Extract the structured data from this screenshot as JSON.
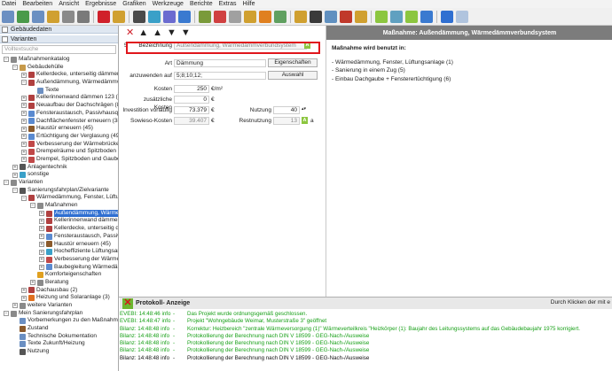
{
  "menu": [
    "Datei",
    "Bearbeiten",
    "Ansicht",
    "Ergebnisse",
    "Grafiken",
    "Werkzeuge",
    "Berichte",
    "Extras",
    "Hilfe"
  ],
  "panel": {
    "gebaeudedaten": "Gebäudedaten",
    "varianten": "Varianten",
    "search_placeholder": "Volltextsuche"
  },
  "tree": [
    {
      "label": "Maßnahmenkatalog",
      "indent": 0,
      "exp": "-",
      "icon": "#8a8a8a"
    },
    {
      "label": "Gebäudehülle",
      "indent": 1,
      "exp": "-",
      "icon": "#c79a4a"
    },
    {
      "label": "Kellerdecke, unterseitig dämmen (",
      "indent": 2,
      "exp": "+",
      "icon": "#b04040"
    },
    {
      "label": "Außendämmung, Wärmedämmverb",
      "indent": 2,
      "exp": "-",
      "icon": "#b04040"
    },
    {
      "label": "Texte",
      "indent": 3,
      "exp": "",
      "icon": "#6b8fc2"
    },
    {
      "label": "Kellerinnenwand dämmen 123 (7)",
      "indent": 2,
      "exp": "+",
      "icon": "#b04040"
    },
    {
      "label": "Neuaufbau der Dachschrägen (8)",
      "indent": 2,
      "exp": "+",
      "icon": "#b04040"
    },
    {
      "label": "Fensteraustausch, Passivhausqualitä",
      "indent": 2,
      "exp": "+",
      "icon": "#5a8ad0"
    },
    {
      "label": "Dachflächenfenster erneuern (38)",
      "indent": 2,
      "exp": "+",
      "icon": "#5a8ad0"
    },
    {
      "label": "Haustür erneuern (45)",
      "indent": 2,
      "exp": "+",
      "icon": "#8b5a2b"
    },
    {
      "label": "Ertüchtigung der Verglasung (49)",
      "indent": 2,
      "exp": "+",
      "icon": "#5a8ad0"
    },
    {
      "label": "Verbesserung der Wärmebrücken, p",
      "indent": 2,
      "exp": "+",
      "icon": "#c04848"
    },
    {
      "label": "Drempelräume und Spitzboden hin",
      "indent": 2,
      "exp": "+",
      "icon": "#c04848"
    },
    {
      "label": "Drempel, Spitzboden und Gaube h",
      "indent": 2,
      "exp": "+",
      "icon": "#c04848"
    },
    {
      "label": "Anlagentechnik",
      "indent": 1,
      "exp": "+",
      "icon": "#555"
    },
    {
      "label": "sonstige",
      "indent": 1,
      "exp": "+",
      "icon": "#3aa0c8"
    },
    {
      "label": "Varianten",
      "indent": 0,
      "exp": "-",
      "icon": "#8a8a8a"
    },
    {
      "label": "Sanierungsfahrplan/Zielvariante",
      "indent": 1,
      "exp": "-",
      "icon": "#555"
    },
    {
      "label": "Wärmedämmung, Fenster, Lüftungs",
      "indent": 2,
      "exp": "-",
      "icon": "#b04040"
    },
    {
      "label": "Maßnahmen",
      "indent": 3,
      "exp": "-",
      "icon": "#8a8a8a"
    },
    {
      "label": "Außendämmung, Wärmedä",
      "indent": 4,
      "exp": "+",
      "icon": "#b04040",
      "sel": true
    },
    {
      "label": "Kellerinnenwand dämmen",
      "indent": 4,
      "exp": "+",
      "icon": "#b04040"
    },
    {
      "label": "Kellerdecke, unterseitig däm",
      "indent": 4,
      "exp": "+",
      "icon": "#b04040"
    },
    {
      "label": "Fensteraustausch, Passivhau",
      "indent": 4,
      "exp": "+",
      "icon": "#5a8ad0"
    },
    {
      "label": "Haustür erneuern (45)",
      "indent": 4,
      "exp": "+",
      "icon": "#8b5a2b"
    },
    {
      "label": "Hocheffiziente Lüftungsanla",
      "indent": 4,
      "exp": "+",
      "icon": "#3aa0c8"
    },
    {
      "label": "Verbesserung der Wärmebr",
      "indent": 4,
      "exp": "+",
      "icon": "#c04848"
    },
    {
      "label": "Baubegleitung Wärmedämm",
      "indent": 4,
      "exp": "+",
      "icon": "#5a8ad0"
    },
    {
      "label": "Komforteigenschaften",
      "indent": 3,
      "exp": "",
      "icon": "#e0a020"
    },
    {
      "label": "Beratung",
      "indent": 3,
      "exp": "+",
      "icon": "#8a8a8a"
    },
    {
      "label": "Dachausbau (2)",
      "indent": 2,
      "exp": "+",
      "icon": "#b04040"
    },
    {
      "label": "Heizung und Solaranlage (3)",
      "indent": 2,
      "exp": "+",
      "icon": "#e07020"
    },
    {
      "label": "weitere Varianten",
      "indent": 1,
      "exp": "+",
      "icon": "#8a8a8a"
    },
    {
      "label": "Mein Sanierungsfahrplan",
      "indent": 0,
      "exp": "-",
      "icon": "#8a8a8a"
    },
    {
      "label": "Vorbemerkungen zu den Maßnahmen",
      "indent": 1,
      "exp": "",
      "icon": "#6b8fc2"
    },
    {
      "label": "Zustand",
      "indent": 1,
      "exp": "",
      "icon": "#8b5a2b"
    },
    {
      "label": "Technische Dokumentation",
      "indent": 1,
      "exp": "",
      "icon": "#6b8fc2"
    },
    {
      "label": "Texte Zukunft/Heizung",
      "indent": 1,
      "exp": "",
      "icon": "#6b8fc2"
    },
    {
      "label": "Nutzung",
      "indent": 1,
      "exp": "",
      "icon": "#555"
    }
  ],
  "form": {
    "nr": "5",
    "bezeichnung_label": "Bezeichnung",
    "bezeichnung_value": "Außendämmung, Wärmedämmverbundsystem",
    "art_label": "Art",
    "art_value": "Dämmung",
    "eigenschaften": "Eigenschaften",
    "anzuwenden_label": "anzuwenden auf",
    "anzuwenden_value": "5;8;10;12;",
    "auswahl": "Auswahl",
    "kosten_label": "Kosten",
    "kosten_value": "250",
    "kosten_unit": "€/m²",
    "zusatz_label": "zusätzliche Kosten",
    "zusatz_value": "0",
    "zusatz_unit": "€",
    "invest_label": "Investition vorläufig",
    "invest_value": "73.379",
    "invest_unit": "€",
    "sowieso_label": "Sowieso-Kosten",
    "sowieso_value": "39.407",
    "sowieso_unit": "€",
    "nutzung_label": "Nutzung",
    "nutzung_value": "40",
    "rest_label": "Restnutzung",
    "rest_value": "13",
    "rest_unit": "a",
    "badge": "A"
  },
  "right": {
    "header": "Maßnahme: Außendämmung, Wärmedämmverbundsystem",
    "title": "Maßnahme wird benutzt in:",
    "items": [
      "- Wärmedämmung, Fenster, Lüftungsanlage (1)",
      "- Sanierung in einem Zug (5)",
      "- Einbau Dachgaube + Fensterertüchtigung (6)"
    ]
  },
  "protocol": {
    "title": "Protokoll- Anzeige",
    "hint": "Durch Klicken der mit e",
    "lines": [
      {
        "a": "EVEBI: 14:48:46 info",
        "b": "-",
        "c": "Das Projekt wurde ordnungsgemäß geschlossen.",
        "k": "g"
      },
      {
        "a": "EVEBI: 14:48:47 info",
        "b": "-",
        "c": "Projekt \"Wohngebäude Weimar, Musterstraße 3\" geöffnet",
        "k": "g"
      },
      {
        "a": "Bilanz: 14:48:48 info",
        "b": "-",
        "c": "Korrektur: Heizbereich \"zentrale Wärmeversorgung (1)\" Wärmeverteilkreis \"Heizkörper (1): Baujahr des Leitungssystems auf das Gebäudebaujahr 1975 korrigiert.",
        "k": "g"
      },
      {
        "a": "Bilanz: 14:48:48 info",
        "b": "-",
        "c": "Protokollierung der Berechnung nach DIN V 18599 - GEG-Nach-/Ausweise",
        "k": "g"
      },
      {
        "a": "Bilanz: 14:48:48 info",
        "b": "-",
        "c": "Protokollierung der Berechnung nach DIN V 18599 - GEG-Nach-/Ausweise",
        "k": "g"
      },
      {
        "a": "Bilanz: 14:48:48 info",
        "b": "-",
        "c": "Protokollierung der Berechnung nach DIN V 18599 - GEG-Nach-/Ausweise",
        "k": "g"
      },
      {
        "a": "Bilanz: 14:48:48 info",
        "b": "-",
        "c": "Protokollierung der Berechnung nach DIN V 18599 - GEG-Nach-/Ausweise",
        "k": "b"
      }
    ]
  },
  "main_toolbar": [
    "✕",
    "▲",
    "▲",
    "▼",
    "▼"
  ],
  "colors": {
    "accent": "#2f6fd1",
    "badge": "#8cc63f",
    "highlight": "#e0161c",
    "header": "#7c7c7c"
  }
}
